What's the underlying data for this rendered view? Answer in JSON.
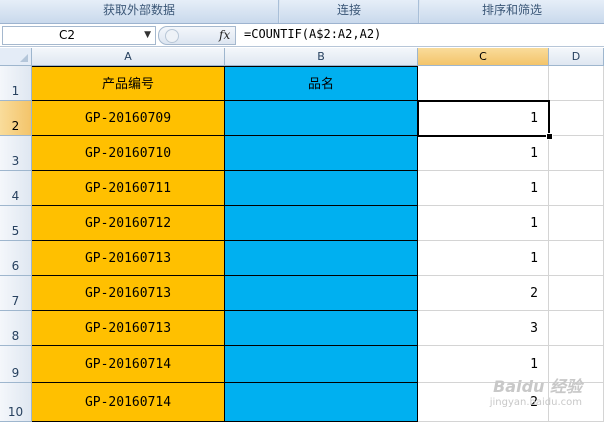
{
  "ribbon": {
    "groups": [
      "获取外部数据",
      "连接",
      "排序和筛选"
    ]
  },
  "formula_bar": {
    "name_box": "C2",
    "fx_label": "fx",
    "formula": "=COUNTIF(A$2:A2,A2)"
  },
  "columns": [
    "A",
    "B",
    "C",
    "D"
  ],
  "rows": [
    "1",
    "2",
    "3",
    "4",
    "5",
    "6",
    "7",
    "8",
    "9",
    "10"
  ],
  "header_row": {
    "a": "产品编号",
    "b": "品名",
    "c": ""
  },
  "data_rows": [
    {
      "a": "GP-20160709",
      "b": "",
      "c": "1"
    },
    {
      "a": "GP-20160710",
      "b": "",
      "c": "1"
    },
    {
      "a": "GP-20160711",
      "b": "",
      "c": "1"
    },
    {
      "a": "GP-20160712",
      "b": "",
      "c": "1"
    },
    {
      "a": "GP-20160713",
      "b": "",
      "c": "1"
    },
    {
      "a": "GP-20160713",
      "b": "",
      "c": "2"
    },
    {
      "a": "GP-20160713",
      "b": "",
      "c": "3"
    },
    {
      "a": "GP-20160714",
      "b": "",
      "c": "1"
    },
    {
      "a": "GP-20160714",
      "b": "",
      "c": "2"
    }
  ],
  "active_cell": "C2",
  "colors": {
    "column_a_fill": "#ffc000",
    "column_b_fill": "#00b0f0",
    "selected_header": "#f3c46a"
  },
  "watermark": {
    "brand": "Baidu 经验",
    "url": "jingyan.baidu.com"
  }
}
